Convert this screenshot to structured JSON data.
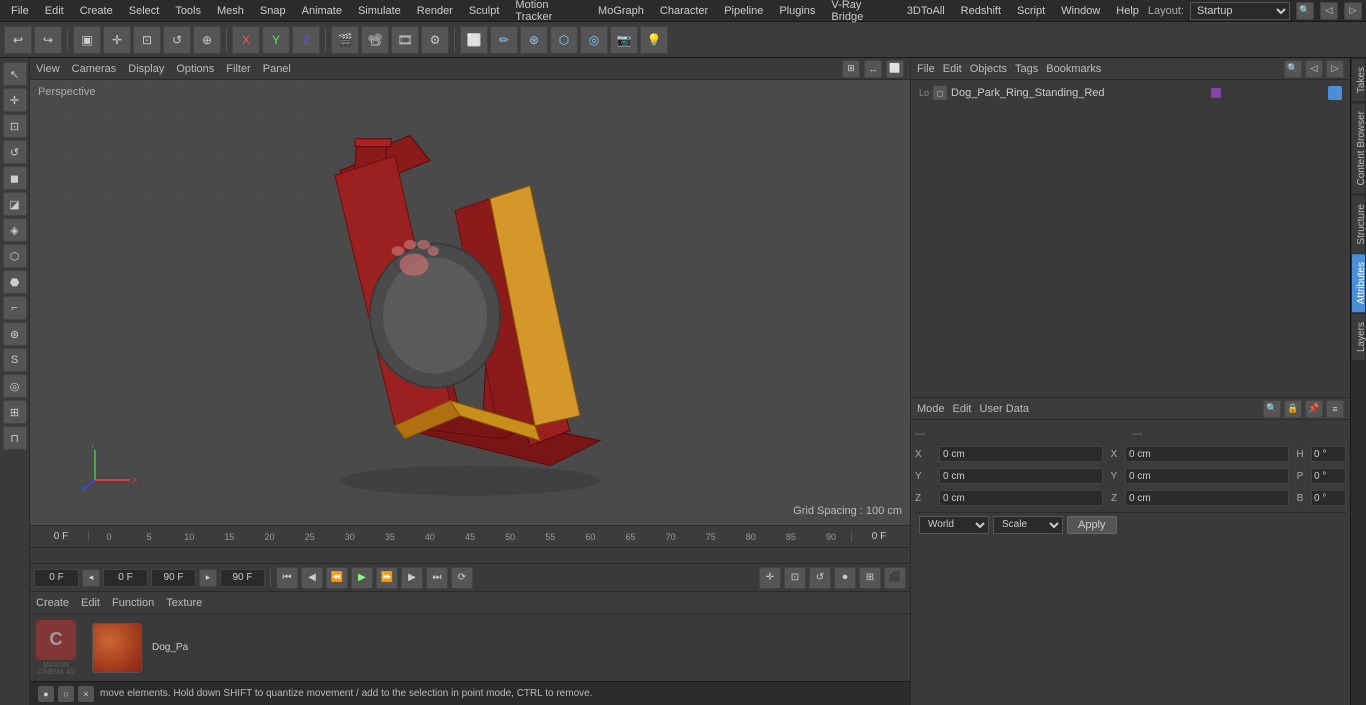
{
  "menu": {
    "items": [
      "File",
      "Edit",
      "Create",
      "Select",
      "Tools",
      "Mesh",
      "Snap",
      "Animate",
      "Simulate",
      "Render",
      "Sculpt",
      "Motion Tracker",
      "MoGraph",
      "Character",
      "Pipeline",
      "Plugins",
      "V-Ray Bridge",
      "3DToAll",
      "Redshift",
      "Script",
      "Window",
      "Help"
    ]
  },
  "layout_label": "Layout:",
  "layout_value": "Startup",
  "toolbar": {
    "undo_icon": "↩",
    "redo_icon": "↪",
    "buttons": [
      "▣",
      "✛",
      "□",
      "↺",
      "⊕",
      "X",
      "Y",
      "Z",
      "▤",
      "▷",
      "⬡",
      "⊛",
      "◎",
      "⬟",
      "◆",
      "▣",
      "▣",
      "▣",
      "◻",
      "◻",
      "◻",
      "◻",
      "◻",
      "◻",
      "◻",
      "⚙",
      "◯"
    ]
  },
  "viewport": {
    "label": "Perspective",
    "menus": [
      "View",
      "Cameras",
      "Display",
      "Options",
      "Filter",
      "Panel"
    ],
    "grid_spacing": "Grid Spacing : 100 cm"
  },
  "timeline": {
    "ticks": [
      "0",
      "5",
      "10",
      "15",
      "20",
      "25",
      "30",
      "35",
      "40",
      "45",
      "50",
      "55",
      "60",
      "65",
      "70",
      "75",
      "80",
      "85",
      "90"
    ],
    "frame_label": "0 F",
    "start_frame": "0 F",
    "end_frame": "90 F",
    "current_frame": "90 F"
  },
  "playback": {
    "start_field": "0 F",
    "end_field": "90 F",
    "current_frame": "0 F",
    "buttons": [
      "⏮",
      "⏪",
      "◀",
      "▶",
      "▶▶",
      "⏭",
      "⟳"
    ]
  },
  "objects_panel": {
    "menus": [
      "File",
      "Edit",
      "Objects",
      "Tags",
      "Bookmarks"
    ],
    "object_name": "Dog_Park_Ring_Standing_Red",
    "object_color": "#8844aa"
  },
  "attributes_panel": {
    "menus": [
      "Mode",
      "Edit",
      "User Data"
    ],
    "coord_labels": [
      "X",
      "Y",
      "Z"
    ],
    "pos_x": "0 cm",
    "pos_y": "0 cm",
    "pos_z": "0 cm",
    "rot_h": "0 °",
    "rot_p": "0 °",
    "rot_b": "0 °",
    "scale_x": "0 cm",
    "scale_y": "0 cm",
    "scale_z": "0 cm",
    "col1_dash": "---",
    "col2_dash": "---"
  },
  "coord_bar": {
    "world_label": "World",
    "scale_label": "Scale",
    "apply_label": "Apply"
  },
  "material": {
    "menus": [
      "Create",
      "Edit",
      "Function",
      "Texture"
    ],
    "item_name": "Dog_Pa"
  },
  "status_bar": {
    "message": "move elements. Hold down SHIFT to quantize movement / add to the selection in point mode, CTRL to remove."
  },
  "right_tabs": [
    "Takes",
    "Content Browser",
    "Structure",
    "Attributes",
    "Layers"
  ],
  "logo": {
    "line1": "MAXON",
    "line2": "CINEMA 4D"
  }
}
